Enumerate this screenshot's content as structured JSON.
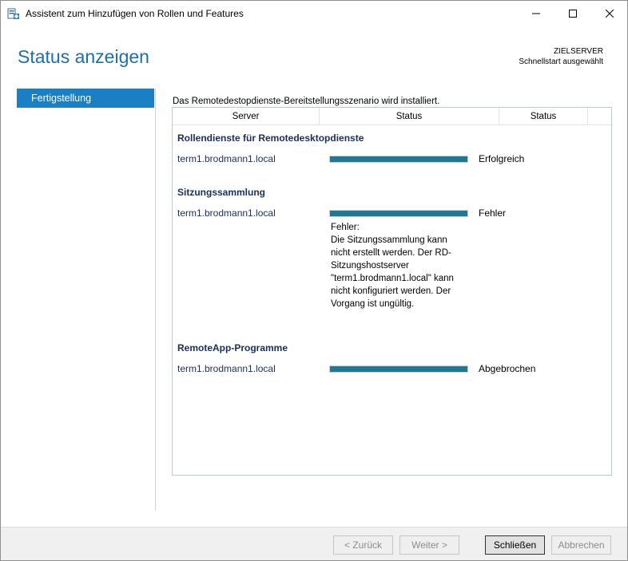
{
  "window": {
    "title": "Assistent zum Hinzufügen von Rollen und Features",
    "icon": "server-manager-wizard-icon"
  },
  "header": {
    "page_title": "Status anzeigen",
    "destination_label": "ZIELSERVER",
    "destination_value": "Schnellstart ausgewählt"
  },
  "nav": {
    "items": [
      {
        "label": "Fertigstellung",
        "selected": true
      }
    ]
  },
  "main": {
    "intro": "Das Remotedestopdienste-Bereitstellungsszenario wird installiert.",
    "columns": [
      "Server",
      "Status",
      "Status",
      ""
    ],
    "sections": [
      {
        "title": "Rollendienste für Remotedesktopdienste",
        "server": "term1.brodmann1.local",
        "progress": 1.0,
        "status": "Erfolgreich",
        "error": []
      },
      {
        "title": "Sitzungssammlung",
        "server": "term1.brodmann1.local",
        "progress": 1.0,
        "status": "Fehler",
        "error": [
          "Fehler:",
          "Die Sitzungssammlung kann",
          "nicht erstellt werden. Der RD-",
          "Sitzungshostserver",
          "\"term1.brodmann1.local\" kann",
          "nicht konfiguriert werden. Der",
          "Vorgang ist ungültig."
        ]
      },
      {
        "title": "RemoteApp-Programme",
        "server": "term1.brodmann1.local",
        "progress": 1.0,
        "status": "Abgebrochen",
        "error": []
      }
    ]
  },
  "footer": {
    "back": "< Zurück",
    "next": "Weiter >",
    "close": "Schließen",
    "cancel": "Abbrechen"
  },
  "colors": {
    "accent": "#1a7fc4",
    "title": "#1e6fa8",
    "progress": "#1f7993",
    "heading": "#1b2d5a"
  }
}
